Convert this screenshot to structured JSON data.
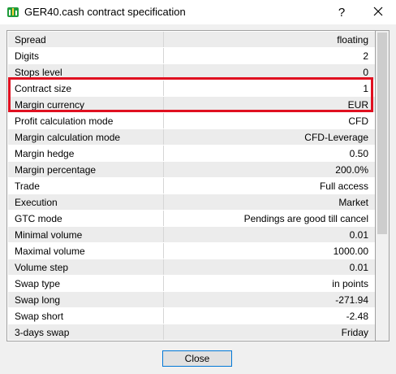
{
  "window": {
    "title": "GER40.cash contract specification",
    "help_label": "?",
    "close_glyph": "×"
  },
  "spec": {
    "rows": [
      {
        "name": "Spread",
        "value": "floating"
      },
      {
        "name": "Digits",
        "value": "2"
      },
      {
        "name": "Stops level",
        "value": "0"
      },
      {
        "name": "Contract size",
        "value": "1"
      },
      {
        "name": "Margin currency",
        "value": "EUR"
      },
      {
        "name": "Profit calculation mode",
        "value": "CFD"
      },
      {
        "name": "Margin calculation mode",
        "value": "CFD-Leverage"
      },
      {
        "name": "Margin hedge",
        "value": "0.50"
      },
      {
        "name": "Margin percentage",
        "value": "200.0%"
      },
      {
        "name": "Trade",
        "value": "Full access"
      },
      {
        "name": "Execution",
        "value": "Market"
      },
      {
        "name": "GTC mode",
        "value": "Pendings are good till cancel"
      },
      {
        "name": "Minimal volume",
        "value": "0.01"
      },
      {
        "name": "Maximal volume",
        "value": "1000.00"
      },
      {
        "name": "Volume step",
        "value": "0.01"
      },
      {
        "name": "Swap type",
        "value": "in points"
      },
      {
        "name": "Swap long",
        "value": "-271.94"
      },
      {
        "name": "Swap short",
        "value": "-2.48"
      },
      {
        "name": "3-days swap",
        "value": "Friday"
      }
    ],
    "highlight_color": "#e01020"
  },
  "footer": {
    "close_label": "Close"
  }
}
